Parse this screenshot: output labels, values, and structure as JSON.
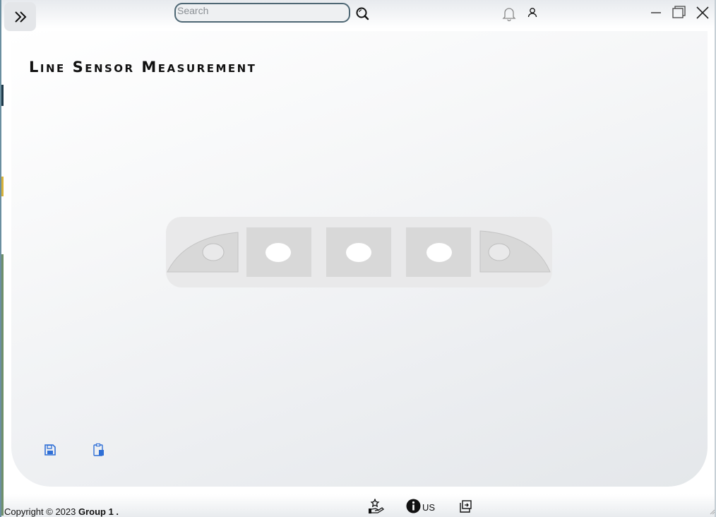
{
  "header": {
    "search_placeholder": "Search",
    "icons": [
      "sidebar-expand-icon",
      "search-icon",
      "bell-icon",
      "user-icon",
      "minimize-icon",
      "maximize-icon",
      "close-icon"
    ]
  },
  "main": {
    "title": "Line Sensor Measurement",
    "sensor_count": 5,
    "toolbar_icons": [
      "save-icon",
      "clipboard-icon"
    ]
  },
  "footer": {
    "copyright_prefix": "Copyright © 2023 ",
    "copyright_group": "Group 1 .",
    "about_label": "US",
    "icons": [
      "hand-star-icon",
      "info-icon",
      "export-icon"
    ]
  },
  "colors": {
    "accent": "#2f6fd6",
    "border": "#4e6774",
    "sensor_tile": "#d8d8d8"
  }
}
